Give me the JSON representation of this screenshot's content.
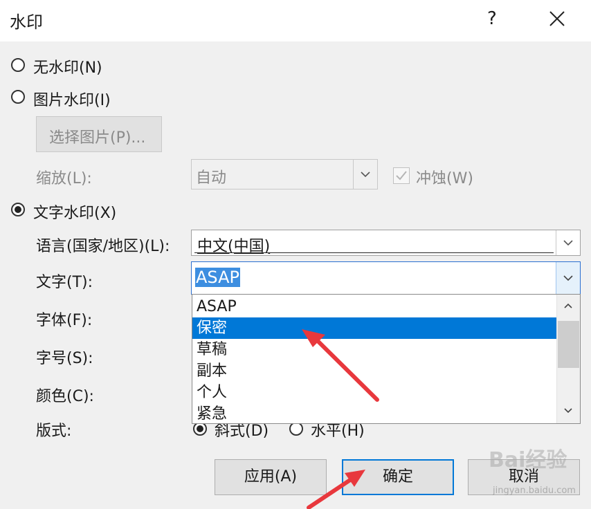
{
  "dialog": {
    "title": "水印",
    "help_label": "?"
  },
  "options": {
    "no_watermark": "无水印(N)",
    "picture_watermark": "图片水印(I)",
    "select_picture": "选择图片(P)...",
    "scale_label": "缩放(L):",
    "scale_value": "自动",
    "washout_label": "冲蚀(W)",
    "text_watermark": "文字水印(X)"
  },
  "text_section": {
    "language_label": "语言(国家/地区)(L):",
    "language_value": "中文(中国)",
    "text_label": "文字(T):",
    "text_value": "ASAP",
    "font_label": "字体(F):",
    "size_label": "字号(S):",
    "color_label": "颜色(C):",
    "layout_label": "版式:",
    "layout_diagonal": "斜式(D)",
    "layout_horizontal": "水平(H)"
  },
  "dropdown": {
    "items": [
      "ASAP",
      "保密",
      "草稿",
      "副本",
      "个人",
      "紧急"
    ],
    "highlighted": "保密"
  },
  "buttons": {
    "apply": "应用(A)",
    "ok": "确定",
    "cancel": "取消"
  },
  "watermark_brand": "Bai经验",
  "watermark_url": "jingyan.baidu.com",
  "colors": {
    "highlight": "#0078d7",
    "arrow": "#e8383d"
  }
}
